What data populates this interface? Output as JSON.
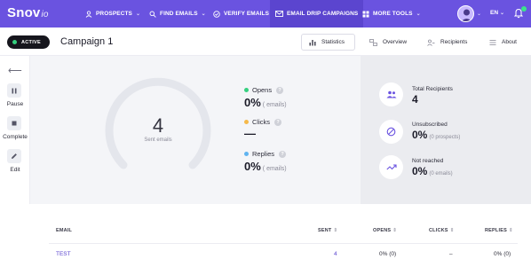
{
  "nav": {
    "logo_main": "Snov",
    "logo_suffix": "io",
    "items": [
      {
        "label": "PROSPECTS",
        "icon": "user-icon"
      },
      {
        "label": "FIND EMAILS",
        "icon": "search-icon"
      },
      {
        "label": "VERIFY EMAILS",
        "icon": "check-circle-icon"
      },
      {
        "label": "EMAIL DRIP CAMPAIGNS",
        "icon": "envelope-icon"
      },
      {
        "label": "MORE TOOLS",
        "icon": "grid-icon"
      }
    ],
    "language": "EN",
    "active_item": "EMAIL DRIP CAMPAIGNS"
  },
  "campaign": {
    "status": "ACTIVE",
    "title": "Campaign 1",
    "tabs": [
      {
        "label": "Statistics",
        "icon": "bar-chart-icon",
        "active": true
      },
      {
        "label": "Overview",
        "icon": "overview-icon",
        "active": false
      },
      {
        "label": "Recipients",
        "icon": "recipients-icon",
        "active": false
      },
      {
        "label": "About",
        "icon": "list-icon",
        "active": false
      }
    ]
  },
  "sidebar": {
    "actions": [
      {
        "label": "Pause",
        "icon": "pause-icon"
      },
      {
        "label": "Complete",
        "icon": "stop-icon"
      },
      {
        "label": "Edit",
        "icon": "pencil-icon"
      }
    ]
  },
  "stats": {
    "sent_value": "4",
    "sent_label": "Sent emails",
    "opens": {
      "label": "Opens",
      "value": "0%",
      "sub": "( emails)",
      "color": "#35d07f"
    },
    "clicks": {
      "label": "Clicks",
      "value": "—",
      "color": "#f5b94a"
    },
    "replies": {
      "label": "Replies",
      "value": "0%",
      "sub": "( emails)",
      "color": "#5fb3f0"
    }
  },
  "summary": {
    "total_recipients": {
      "label": "Total Recipients",
      "value": "4",
      "icon": "people-icon"
    },
    "unsubscribed": {
      "label": "Unsubscribed",
      "value": "0%",
      "sub": "(0 prospects)",
      "icon": "ban-icon"
    },
    "not_reached": {
      "label": "Not reached",
      "value": "0%",
      "sub": "(0 emails)",
      "icon": "trend-icon"
    }
  },
  "table": {
    "headers": [
      "EMAIL",
      "SENT",
      "OPENS",
      "CLICKS",
      "REPLIES"
    ],
    "rows": [
      {
        "email": "TEST",
        "sent": "4",
        "opens": "0% (0)",
        "clicks": "–",
        "replies": "0% (0)"
      }
    ]
  },
  "colors": {
    "brand": "#6a53e0",
    "active_status": "#35d07f",
    "link": "#5b45cf"
  }
}
